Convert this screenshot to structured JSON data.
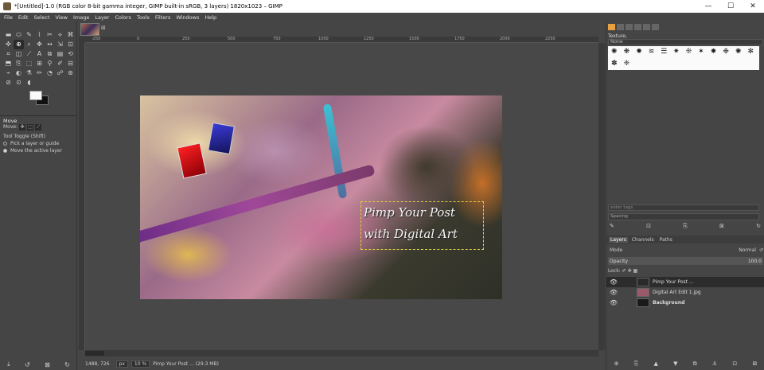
{
  "window": {
    "title": "*[Untitled]-1.0 (RGB color 8-bit gamma integer, GIMP built-in sRGB, 3 layers) 1820x1023 – GIMP",
    "minimize": "—",
    "maximize": "☐",
    "close": "✕"
  },
  "menu": [
    "File",
    "Edit",
    "Select",
    "View",
    "Image",
    "Layer",
    "Colors",
    "Tools",
    "Filters",
    "Windows",
    "Help"
  ],
  "toolbox": {
    "tools": [
      "▬",
      "⬭",
      "✎",
      "⌇",
      "✂",
      "⟡",
      "⌘",
      "✜",
      "⊕",
      "⌕",
      "✥",
      "↔",
      "⇲",
      "⊡",
      "⌗",
      "◫",
      "⟋",
      "A",
      "⧉",
      "▤",
      "⟲",
      "⬒",
      "⎘",
      "⬚",
      "⊞",
      "⚲",
      "✐",
      "⊟",
      "⌁",
      "◐",
      "⚗",
      "✏",
      "◔",
      "☍",
      "⊛",
      "⊘",
      "⊙",
      "◖"
    ],
    "move_label": "Move",
    "move_row_label": "Move:",
    "toggle_label": "Tool Toggle  (Shift)",
    "option_pick": "Pick a layer or guide",
    "option_move_active": "Move the active layer",
    "bottom_icons": [
      "⤓",
      "↺",
      "⊠",
      "↻"
    ]
  },
  "canvas": {
    "ruler_labels": [
      "-250",
      "0",
      "250",
      "500",
      "750",
      "1000",
      "1250",
      "1500",
      "1750",
      "2000",
      "2250"
    ],
    "text_line1": "Pimp Your Post",
    "text_line2": "with Digital Art"
  },
  "status": {
    "coords": "1488, 726",
    "unit": "px",
    "zoom": "10 %",
    "layer_info": "Pimp Your Post ... (29.3 MB)"
  },
  "brushes": {
    "name": "Texture,",
    "tag": "None",
    "tag_placeholder": "enter tags",
    "spacing_label": "Spacing",
    "cells": [
      "✺",
      "❋",
      "✹",
      "≋",
      "☰",
      "✷",
      "❊",
      "✶",
      "✸",
      "❉",
      "✺",
      "✻",
      "✽",
      "❈"
    ],
    "actions": [
      "✎",
      "⊡",
      "⎘",
      "⊠",
      "↻"
    ]
  },
  "layers": {
    "tabs": [
      "Layers",
      "Channels",
      "Paths"
    ],
    "mode_label": "Mode",
    "mode_value": "Normal",
    "opacity_label": "Opacity",
    "opacity_value": "100.0",
    "lock_label": "Lock:",
    "items": [
      {
        "name": "Pimp Your Post ...",
        "visible": "👁",
        "bold": false,
        "thumb": "#2a2a2a"
      },
      {
        "name": "Digital Art Edit 1.jpg",
        "visible": "👁",
        "bold": false,
        "thumb": "#9a5a6a"
      },
      {
        "name": "Background",
        "visible": "👁",
        "bold": true,
        "thumb": "#1a1a1a"
      }
    ],
    "bottom_icons": [
      "⊕",
      "⎘",
      "▲",
      "▼",
      "⧉",
      "⚓",
      "⊡",
      "⊠"
    ]
  }
}
